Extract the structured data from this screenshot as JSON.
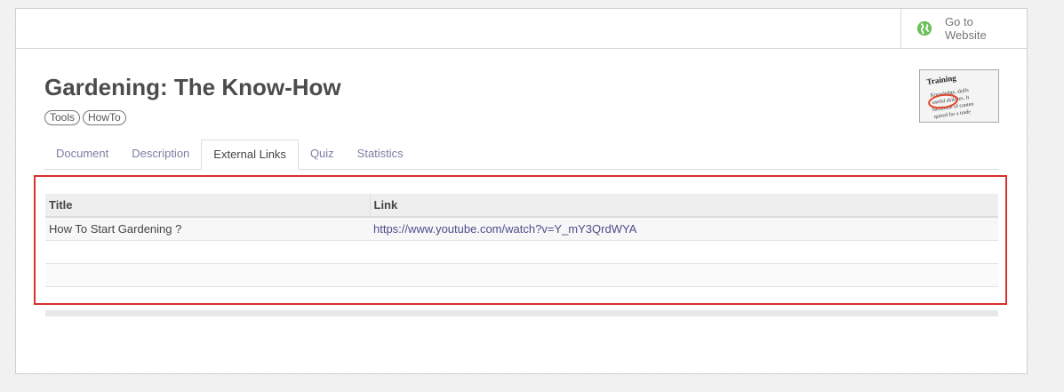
{
  "header": {
    "website_button": {
      "label": "Go to Website",
      "icon": "globe-icon"
    }
  },
  "record": {
    "title": "Gardening: The Know-How",
    "tags": [
      "Tools",
      "HowTo"
    ],
    "thumbnail": {
      "heading": "Training",
      "lines": [
        "Knowledge, skills",
        "useful abilities. It",
        "backbone of conten",
        "quired for a trade",
        "other fields."
      ]
    }
  },
  "tabs": [
    {
      "label": "Document",
      "active": false
    },
    {
      "label": "Description",
      "active": false
    },
    {
      "label": "External Links",
      "active": true
    },
    {
      "label": "Quiz",
      "active": false
    },
    {
      "label": "Statistics",
      "active": false
    }
  ],
  "links_table": {
    "columns": [
      "Title",
      "Link"
    ],
    "rows": [
      {
        "title": "How To Start Gardening ?",
        "link": "https://www.youtube.com/watch?v=Y_mY3QrdWYA"
      }
    ]
  },
  "colors": {
    "highlight": "#d9312c",
    "tab_link": "#7a7ea3",
    "globe": "#6cbf5a"
  }
}
